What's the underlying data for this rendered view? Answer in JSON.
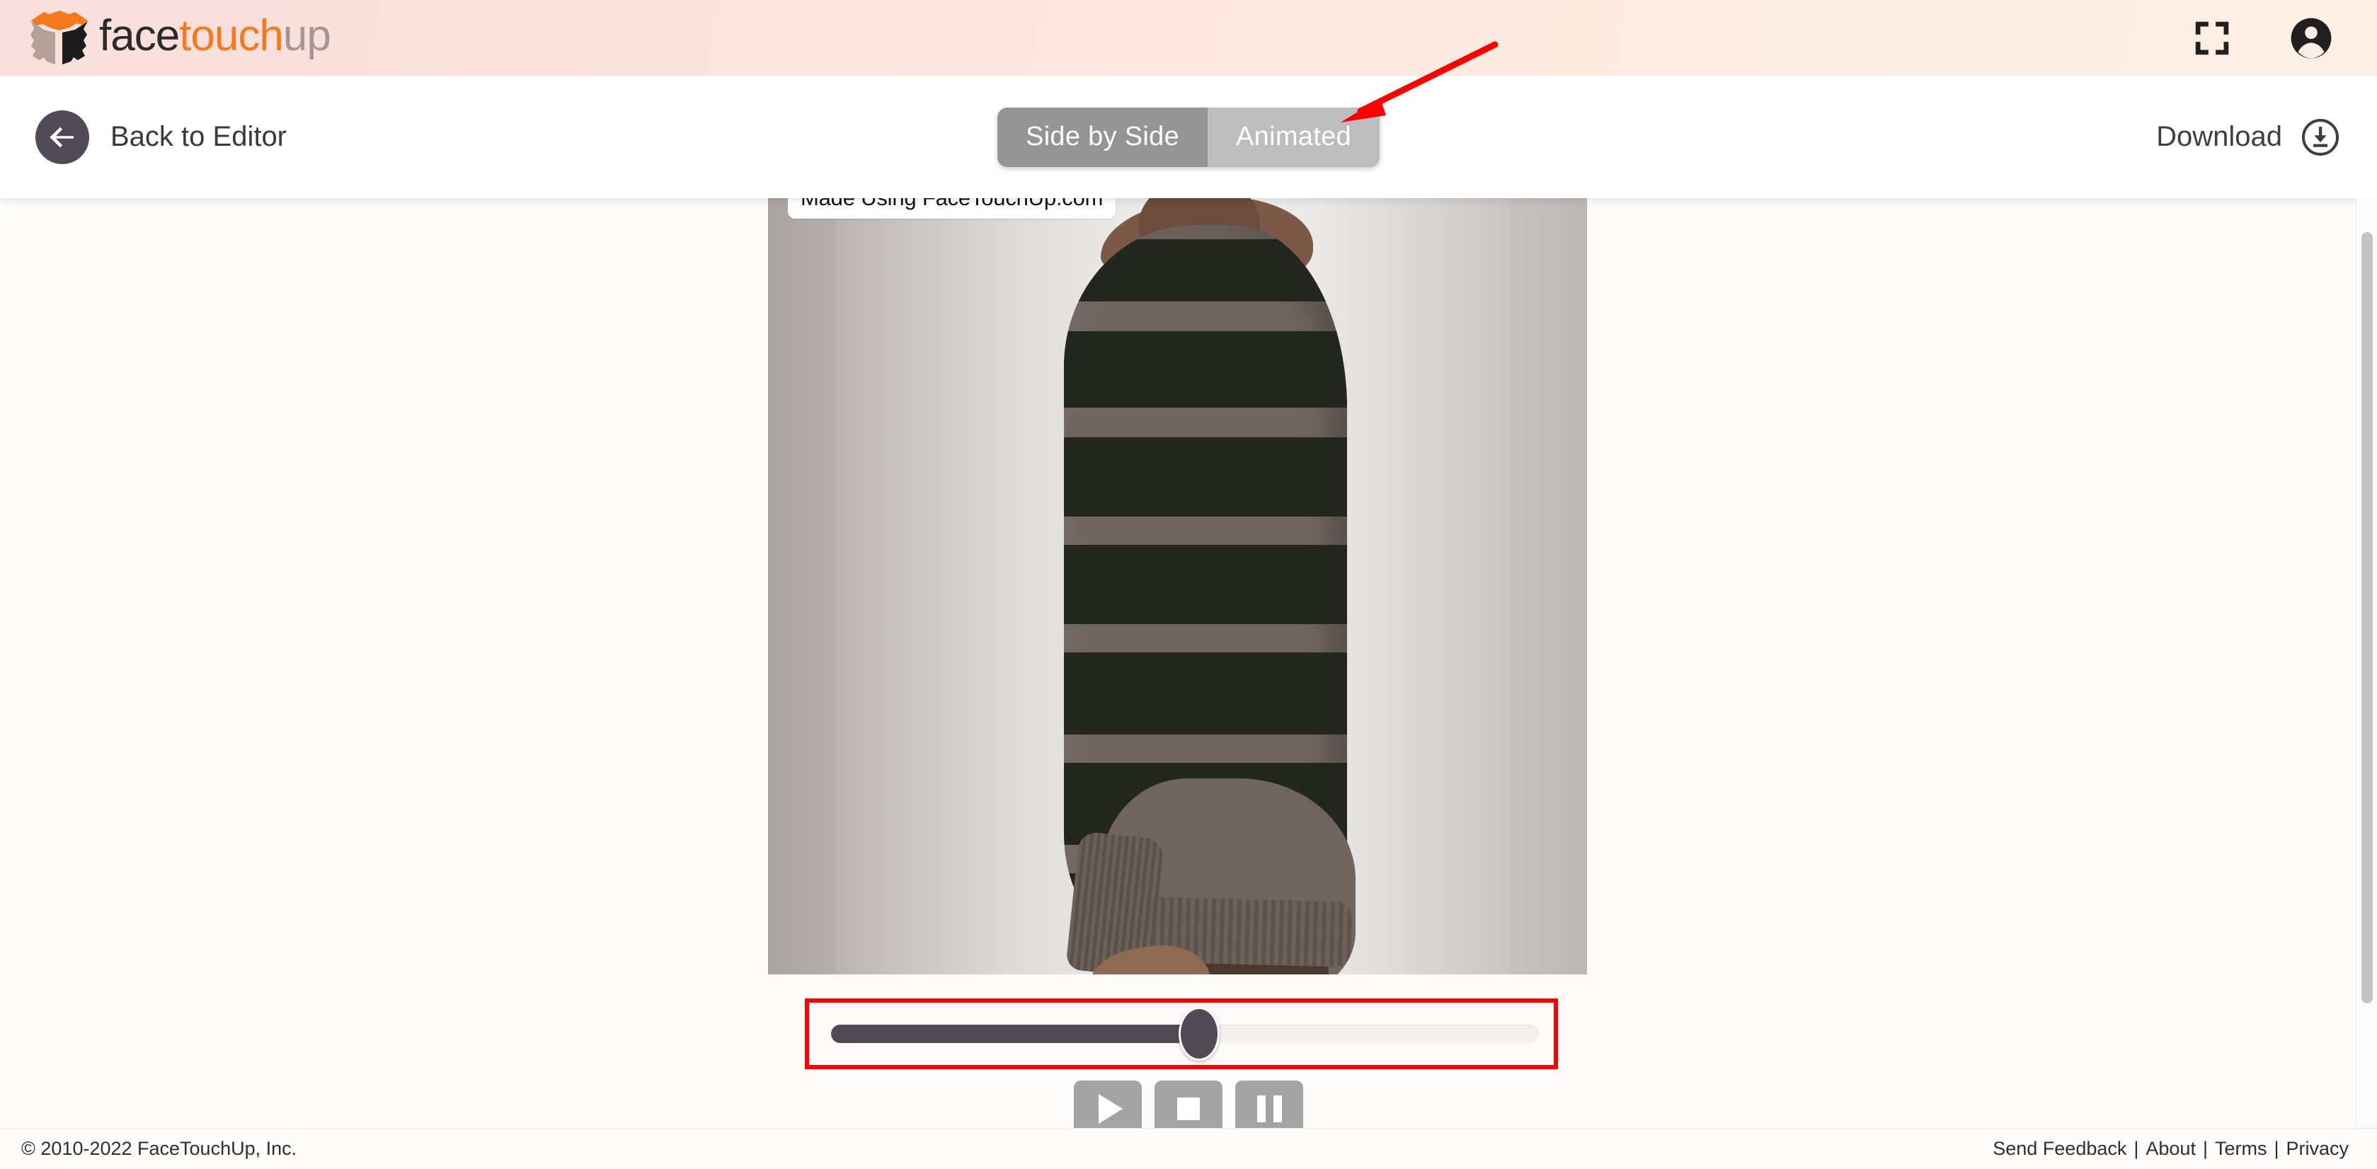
{
  "header": {
    "brand": {
      "logo_icon": "facetouchup-cube-logo-icon",
      "word_face": "face",
      "word_touch": "touch",
      "word_up": "up"
    },
    "fullscreen_icon": "fullscreen-icon",
    "account_icon": "account-avatar-icon"
  },
  "toolbar": {
    "back_icon": "back-arrow-icon",
    "back_label": "Back to Editor",
    "tabs": [
      {
        "label": "Side by Side",
        "active": false
      },
      {
        "label": "Animated",
        "active": true
      }
    ],
    "download_label": "Download",
    "download_icon": "download-circle-icon"
  },
  "stage": {
    "watermark": "Made Using FaceTouchUp.com",
    "photo_alt": "Profile view of a woman wearing a striped sweater dress",
    "annotation": {
      "arrow_color": "#fd0000",
      "arrow_target": "Animated",
      "highlight_color": "#fd0000",
      "highlight_target": "playback-slider"
    }
  },
  "player": {
    "slider": {
      "value_percent": 52,
      "min": 0,
      "max": 100
    },
    "controls": [
      {
        "name": "play-button",
        "icon": "play-icon"
      },
      {
        "name": "stop-button",
        "icon": "stop-icon"
      },
      {
        "name": "pause-button",
        "icon": "pause-icon"
      }
    ]
  },
  "footer": {
    "copyright": "© 2010-2022 FaceTouchUp, Inc.",
    "links": [
      "Send Feedback",
      "About",
      "Terms",
      "Privacy"
    ],
    "separator": "|"
  },
  "colors": {
    "header_gradient_start": "#fadfdc",
    "header_gradient_end": "#fdf0e4",
    "brand_orange": "#f5791f",
    "brand_gray": "#a59890",
    "dark_ui": "#4f4a56",
    "tab_inactive": "#949494",
    "tab_active": "#bdbdbd",
    "annotation_red": "#fd0000"
  }
}
